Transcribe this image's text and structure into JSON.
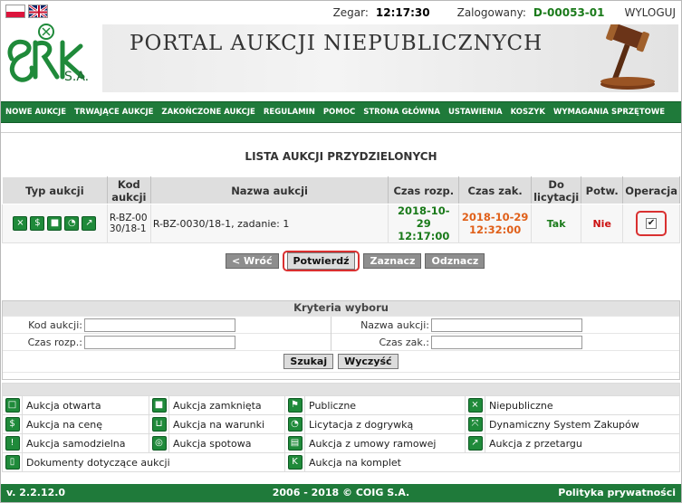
{
  "header": {
    "flags": [
      "PL",
      "EN"
    ],
    "clock_label": "Zegar:",
    "clock_value": "12:17:30",
    "logged_label": "Zalogowany:",
    "logged_value": "D-00053-01",
    "logout": "WYLOGUJ",
    "logo_sub": "S.A.",
    "banner_title": "PORTAL AUKCJI NIEPUBLICZNYCH"
  },
  "nav": {
    "items": [
      "NOWE AUKCJE",
      "TRWAJĄCE AUKCJE",
      "ZAKOŃCZONE AUKCJE",
      "REGULAMIN",
      "POMOC",
      "STRONA GŁÓWNA",
      "USTAWIENIA",
      "KOSZYK",
      "WYMAGANIA SPRZĘTOWE"
    ]
  },
  "list": {
    "title": "LISTA AUKCJI PRZYDZIELONYCH",
    "headers": [
      "Typ aukcji",
      "Kod aukcji",
      "Nazwa aukcji",
      "Czas rozp.",
      "Czas zak.",
      "Do licytacji",
      "Potw.",
      "Operacja"
    ],
    "row": {
      "type_icons": [
        "criss-cross-icon",
        "dollar-icon",
        "lock-icon",
        "clock-icon",
        "arrow-out-icon"
      ],
      "code": "R-BZ-0030/18-1",
      "name": "R-BZ-0030/18-1, zadanie: 1",
      "start_date": "2018-10-29",
      "start_time": "12:17:00",
      "end_date": "2018-10-29",
      "end_time": "12:32:00",
      "do_licytacji": "Tak",
      "potw": "Nie",
      "checked": true
    }
  },
  "buttons": {
    "back": "< Wróć",
    "confirm": "Potwierdź",
    "select": "Zaznacz",
    "deselect": "Odznacz"
  },
  "criteria": {
    "title": "Kryteria wyboru",
    "code_label": "Kod aukcji:",
    "name_label": "Nazwa aukcji:",
    "start_label": "Czas rozp.:",
    "end_label": "Czas zak.:",
    "search": "Szukaj",
    "clear": "Wyczyść"
  },
  "legend": {
    "c1": [
      "Aukcja otwarta",
      "Aukcja na cenę",
      "Aukcja samodzielna",
      "Dokumenty dotyczące aukcji"
    ],
    "c2": [
      "Aukcja zamknięta",
      "Aukcja na warunki",
      "Aukcja spotowa"
    ],
    "c3": [
      "Publiczne",
      "Licytacja z dogrywką",
      "Aukcja z umowy ramowej",
      "Aukcja na komplet"
    ],
    "c4": [
      "Niepubliczne",
      "Dynamiczny System Zakupów",
      "Aukcja z przetargu"
    ]
  },
  "footer": {
    "version": "v. 2.2.12.0",
    "copyright": "2006 - 2018 © COIG S.A.",
    "policy": "Polityka prywatności"
  },
  "colors": {
    "brand_green": "#1f7a3a",
    "highlight_red": "#d93030",
    "date_green": "#1a7a1a",
    "date_orange": "#e0601a"
  }
}
